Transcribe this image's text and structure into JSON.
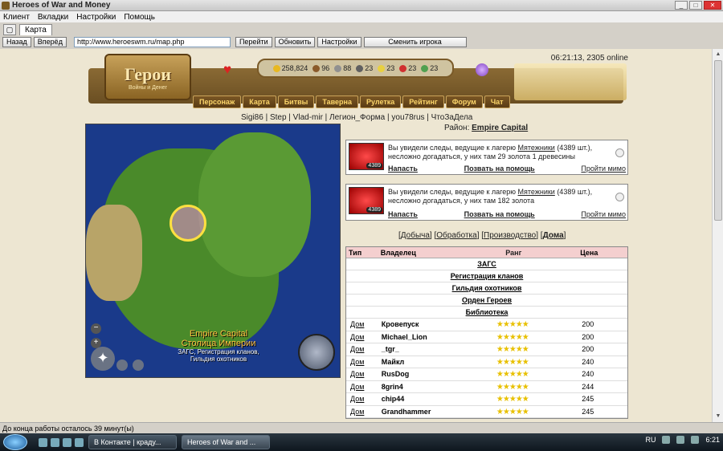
{
  "window": {
    "title": "Heroes of War and Money",
    "min": "_",
    "max": "□",
    "close": "✕"
  },
  "menu": [
    "Клиент",
    "Вкладки",
    "Настройки",
    "Помощь"
  ],
  "tabs": {
    "active_tab": "Карта"
  },
  "nav": {
    "back": "Назад",
    "forward": "Вперёд",
    "url": "http://www.heroeswm.ru/map.php",
    "go": "Перейти",
    "refresh": "Обновить",
    "settings": "Настройки",
    "change_player": "Сменить игрока"
  },
  "header": {
    "logo_main": "Герои",
    "logo_sub": "Войны и Денег",
    "clock": "06:21:13, 2305 online",
    "resources": [
      {
        "value": "258,824",
        "color": "#e8b820"
      },
      {
        "value": "96",
        "color": "#8a5a2a"
      },
      {
        "value": "88",
        "color": "#909090"
      },
      {
        "value": "23",
        "color": "#606060"
      },
      {
        "value": "23",
        "color": "#e8d040"
      },
      {
        "value": "23",
        "color": "#d03030"
      },
      {
        "value": "23",
        "color": "#50a050"
      }
    ],
    "menu": [
      "Персонаж",
      "Карта",
      "Битвы",
      "Таверна",
      "Рулетка",
      "Рейтинг",
      "Форум",
      "Чат"
    ]
  },
  "online_links": "Sigi86 | Step | Vlad-mir | Легион_Форма | you78rus | ЧтоЗаДела",
  "map": {
    "name_en": "Empire Capital",
    "name_ru": "Столица Империи",
    "buildings": "ЗАГС, Регистрация кланов,",
    "buildings2": "Гильдия охотников",
    "zoom_out": "−",
    "zoom_in": "+"
  },
  "district": {
    "label": "Район:",
    "name": "Empire Capital"
  },
  "events": [
    {
      "count": "4389",
      "text_prefix": "Вы увидели следы, ведущие к лагерю ",
      "link": "Мятежники",
      "text_suffix": " (4389 шт.), несложно догадаться, у них там 29 золота 1 древесины",
      "attack": "Напасть",
      "help": "Позвать на помощь",
      "skip": "Пройти мимо"
    },
    {
      "count": "4389",
      "text_prefix": "Вы увидели следы, ведущие к лагерю ",
      "link": "Мятежники",
      "text_suffix": " (4389 шт.), несложно догадаться, у них там 182 золота",
      "attack": "Напасть",
      "help": "Позвать на помощь",
      "skip": "Пройти мимо"
    }
  ],
  "filters": {
    "mining": "Добыча",
    "processing": "Обработка",
    "production": "Производство",
    "houses": "Дома"
  },
  "table": {
    "headers": {
      "type": "Тип",
      "owner": "Владелец",
      "rank": "Ранг",
      "price": "Цена"
    },
    "special_rows": [
      "ЗАГС",
      "Регистрация кланов",
      "Гильдия охотников",
      "Орден Героев",
      "Библиотека"
    ],
    "rows": [
      {
        "type": "Дом",
        "owner": "Кровепуск",
        "rank": "★★★★★",
        "price": "200"
      },
      {
        "type": "Дом",
        "owner": "Michael_Lion",
        "rank": "★★★★★",
        "price": "200"
      },
      {
        "type": "Дом",
        "owner": "_tgr_",
        "rank": "★★★★★",
        "price": "200"
      },
      {
        "type": "Дом",
        "owner": "Майкл",
        "rank": "★★★★★",
        "price": "240"
      },
      {
        "type": "Дом",
        "owner": "RusDog",
        "rank": "★★★★★",
        "price": "240"
      },
      {
        "type": "Дом",
        "owner": "8grin4",
        "rank": "★★★★★",
        "price": "244"
      },
      {
        "type": "Дом",
        "owner": "chip44",
        "rank": "★★★★★",
        "price": "245"
      },
      {
        "type": "Дом",
        "owner": "Grandhammer",
        "rank": "★★★★★",
        "price": "245"
      }
    ]
  },
  "status": "До конца работы осталось 39 минут(ы)",
  "taskbar": {
    "task1": "В Контакте | краду...",
    "task2": "Heroes of War and ...",
    "lang": "RU",
    "time": "6:21"
  }
}
